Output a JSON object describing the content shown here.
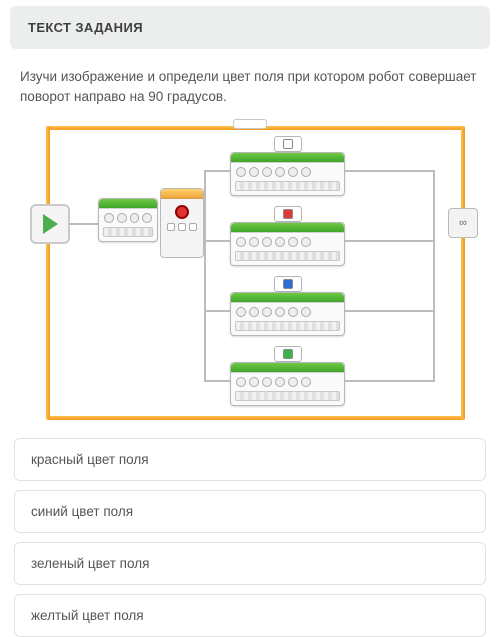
{
  "header": {
    "title": "ТЕКСТ ЗАДАНИЯ"
  },
  "question": {
    "text": "Изучи изображение и определи цвет поля при котором робот совершает поворот направо на 90 градусов."
  },
  "diagram": {
    "start_icon": "play-icon",
    "end_icon": "loop-end-icon",
    "switch_sensor": "color-sensor",
    "cases": [
      {
        "color_name": "white",
        "color_hex": "#ffffff"
      },
      {
        "color_name": "red",
        "color_hex": "#e03a3a"
      },
      {
        "color_name": "blue",
        "color_hex": "#2b6fd6"
      },
      {
        "color_name": "green",
        "color_hex": "#3bb14a"
      }
    ]
  },
  "options": [
    {
      "label": "красный цвет поля"
    },
    {
      "label": "синий цвет поля"
    },
    {
      "label": "зеленый цвет поля"
    },
    {
      "label": "желтый цвет поля"
    }
  ]
}
